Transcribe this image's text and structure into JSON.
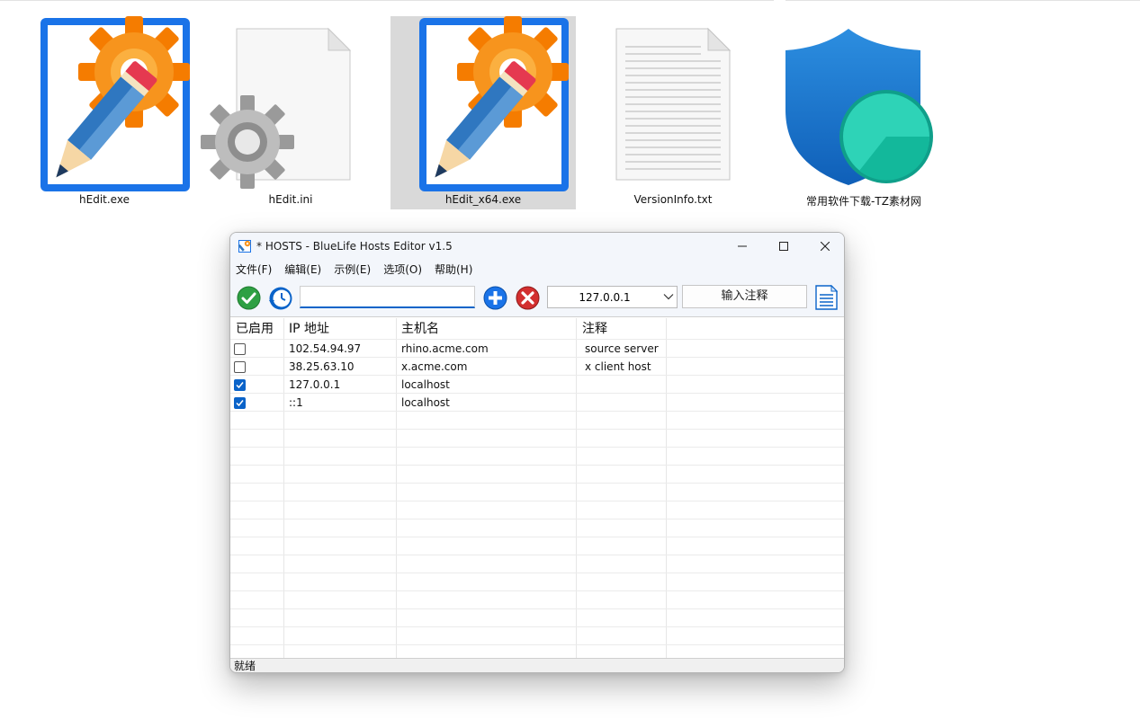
{
  "desktop": {
    "files": [
      {
        "name": "hEdit.exe",
        "icon": "hedit-app-icon",
        "selected": false
      },
      {
        "name": "hEdit.ini",
        "icon": "ini-settings-file-icon",
        "selected": false
      },
      {
        "name": "hEdit_x64.exe",
        "icon": "hedit-app-icon",
        "selected": true
      },
      {
        "name": "VersionInfo.txt",
        "icon": "text-file-icon",
        "selected": false
      },
      {
        "name": "常用软件下载-TZ素材网",
        "icon": "shield-shortcut-icon",
        "selected": false
      }
    ]
  },
  "window": {
    "title": "* HOSTS - BlueLife Hosts Editor v1.5",
    "menu": [
      "文件(F)",
      "编辑(E)",
      "示例(E)",
      "选项(O)",
      "帮助(H)"
    ],
    "toolbar": {
      "search_value": "",
      "ip_selected": "127.0.0.1",
      "comment_placeholder": "输入注释"
    },
    "columns": [
      "已启用",
      "IP 地址",
      "主机名",
      "注释"
    ],
    "rows": [
      {
        "enabled": false,
        "ip": "102.54.94.97",
        "host": "rhino.acme.com",
        "comment": "source server"
      },
      {
        "enabled": false,
        "ip": "38.25.63.10",
        "host": "x.acme.com",
        "comment": "x client host"
      },
      {
        "enabled": true,
        "ip": "127.0.0.1",
        "host": "localhost",
        "comment": ""
      },
      {
        "enabled": true,
        "ip": "::1",
        "host": "localhost",
        "comment": ""
      }
    ],
    "status": "就绪"
  },
  "colors": {
    "accent": "#0a63c9",
    "save_green": "#2ea043",
    "delete_red": "#d32f2f",
    "window_bg": "#f3f6fb"
  }
}
